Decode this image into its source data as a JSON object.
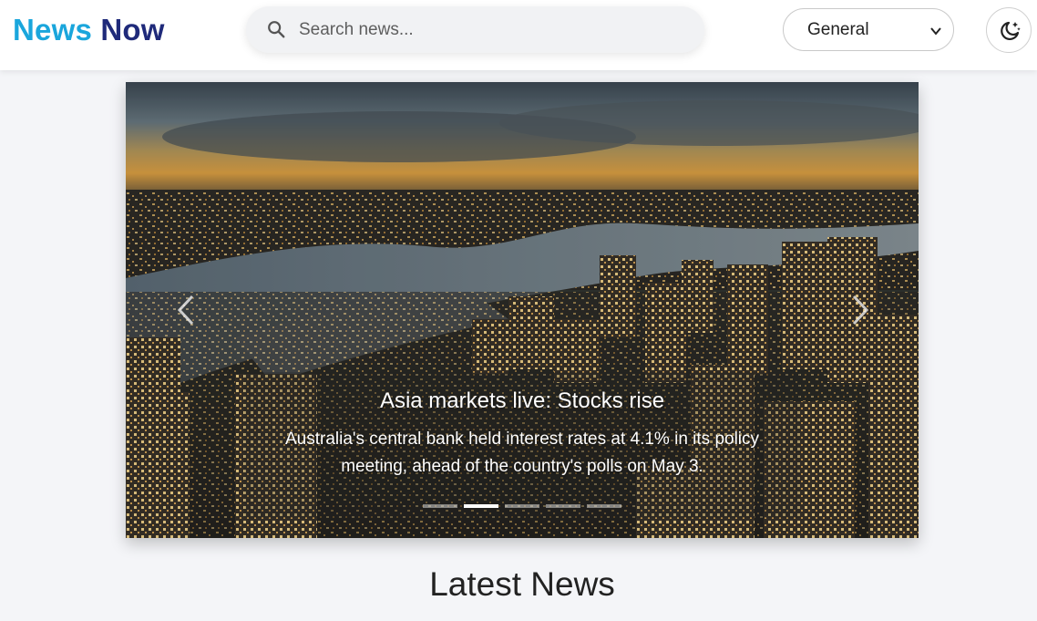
{
  "header": {
    "logo_part1": "News",
    "logo_part2": "Now",
    "search_placeholder": "Search news...",
    "category_selected": "General",
    "theme_icon": "moon-stars-icon"
  },
  "carousel": {
    "slide_title": "Asia markets live: Stocks rise",
    "slide_description": "Australia's central bank held interest rates at 4.1% in its policy meeting, ahead of the country's polls on May 3.",
    "active_index": 1,
    "slide_count": 5
  },
  "main": {
    "section_title": "Latest News"
  },
  "colors": {
    "logo_accent": "#1aa6dc",
    "logo_dark": "#1f2a7a",
    "page_bg": "#f4f5f8"
  }
}
